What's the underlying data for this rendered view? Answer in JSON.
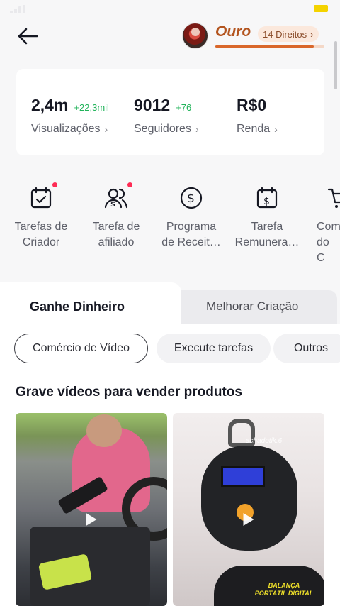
{
  "header": {
    "tier_name": "Ouro",
    "rights_label": "14 Direitos",
    "tier_progress": 0.9
  },
  "stats": [
    {
      "value": "2,4m",
      "delta": "+22,3mil",
      "label": "Visualizações"
    },
    {
      "value": "9012",
      "delta": "+76",
      "label": "Seguidores"
    },
    {
      "value": "R$0",
      "delta": "",
      "label": "Renda"
    }
  ],
  "tools": [
    {
      "label": "Tarefas de\nCriador",
      "icon": "calendar-check-icon",
      "notification": true
    },
    {
      "label": "Tarefa de\nafiliado",
      "icon": "users-dollar-icon",
      "notification": true
    },
    {
      "label": "Programa\nde Receit…",
      "icon": "dollar-circle-icon",
      "notification": false
    },
    {
      "label": "Tarefa\nRemunera…",
      "icon": "calendar-dollar-icon",
      "notification": false
    },
    {
      "label": "Com\ndo C",
      "icon": "cart-icon",
      "notification": false
    }
  ],
  "tabs": [
    {
      "label": "Ganhe Dinheiro",
      "active": true
    },
    {
      "label": "Melhorar Criação",
      "active": false
    }
  ],
  "chips": [
    {
      "label": "Comércio de Vídeo",
      "active": true
    },
    {
      "label": "Execute tarefas",
      "active": false
    },
    {
      "label": "Outros",
      "active": false
    }
  ],
  "section_title": "Grave vídeos para vender produtos",
  "videos": [
    {
      "caption": ""
    },
    {
      "caption": "BALANÇA PORTÁTIL DIGITAL",
      "watermark": "achadotik.6"
    }
  ],
  "colors": {
    "accent": "#fe2c55",
    "delta_green": "#21b35a",
    "tier_color": "#b3541e",
    "tier_bar_fill": "#d9672b"
  }
}
